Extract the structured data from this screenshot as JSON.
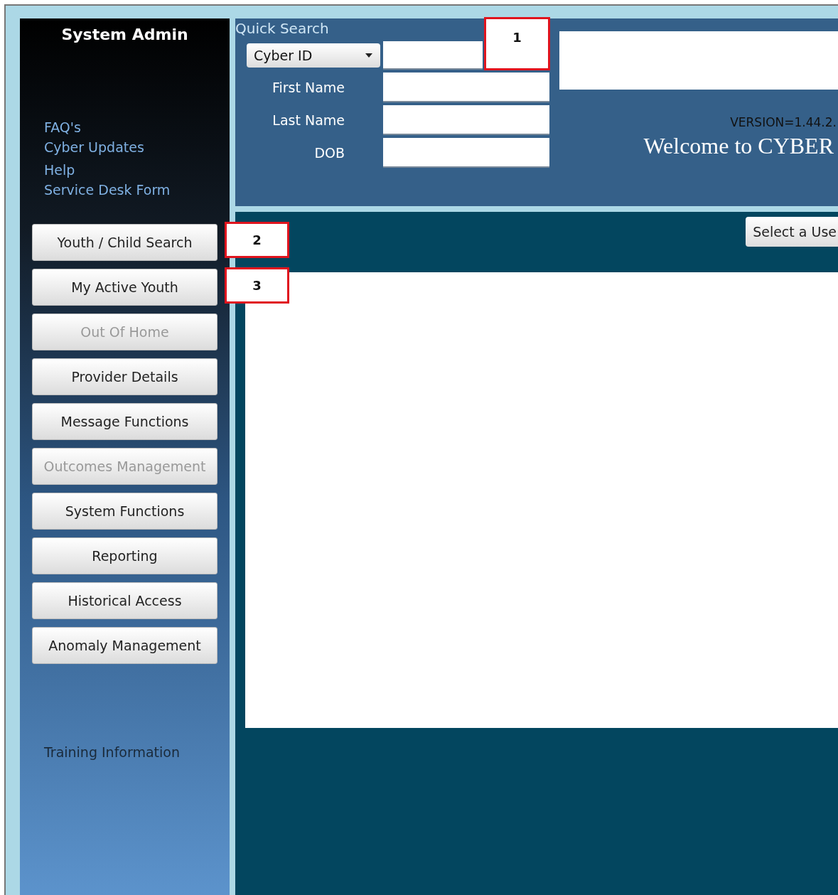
{
  "sidebar": {
    "title": "System Admin",
    "links": [
      "FAQ's",
      "Cyber Updates",
      "Help",
      "Service Desk Form"
    ],
    "nav_buttons": [
      {
        "label": "Youth / Child Search",
        "disabled": false
      },
      {
        "label": "My Active Youth",
        "disabled": false
      },
      {
        "label": "Out Of Home",
        "disabled": true
      },
      {
        "label": "Provider Details",
        "disabled": false
      },
      {
        "label": "Message Functions",
        "disabled": false
      },
      {
        "label": "Outcomes Management",
        "disabled": true
      },
      {
        "label": "System Functions",
        "disabled": false
      },
      {
        "label": "Reporting",
        "disabled": false
      },
      {
        "label": "Historical Access",
        "disabled": false
      },
      {
        "label": "Anomaly Management",
        "disabled": false
      }
    ],
    "footer_link": "Training Information"
  },
  "quick_search": {
    "title": "Quick Search",
    "search_type": "Cyber ID",
    "fields": [
      {
        "label": "First Name"
      },
      {
        "label": "Last Name"
      },
      {
        "label": "DOB"
      }
    ]
  },
  "version": "VERSION=1.44.2.",
  "welcome": "Welcome to CYBER",
  "select_user_button": "Select a Use",
  "callouts": [
    {
      "label": "1"
    },
    {
      "label": "2"
    },
    {
      "label": "3"
    }
  ]
}
